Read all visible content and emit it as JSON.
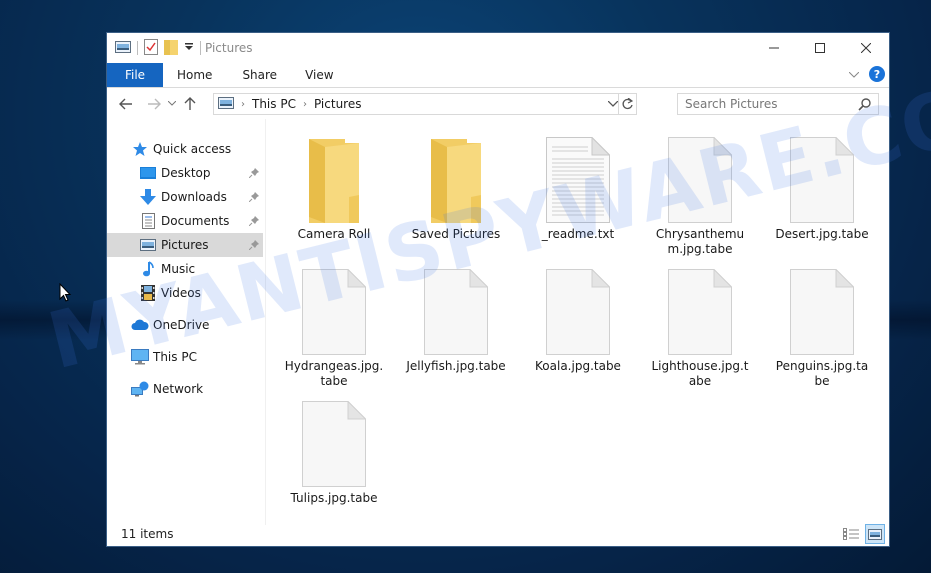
{
  "window": {
    "title": "Pictures",
    "controls": {
      "minimize": "—",
      "maximize": "☐",
      "close": "✕"
    }
  },
  "ribbon": {
    "tabs": [
      {
        "label": "File",
        "active": true
      },
      {
        "label": "Home"
      },
      {
        "label": "Share"
      },
      {
        "label": "View"
      }
    ],
    "help_label": "?"
  },
  "navigation": {
    "breadcrumb": [
      "This PC",
      "Pictures"
    ],
    "search_placeholder": "Search Pictures"
  },
  "sidebar": {
    "items": [
      {
        "label": "Quick access",
        "icon": "star-icon"
      },
      {
        "label": "Desktop",
        "icon": "desktop-icon",
        "pinned": true
      },
      {
        "label": "Downloads",
        "icon": "download-arrow-icon",
        "pinned": true
      },
      {
        "label": "Documents",
        "icon": "document-icon",
        "pinned": true
      },
      {
        "label": "Pictures",
        "icon": "pictures-icon",
        "pinned": true,
        "selected": true
      },
      {
        "label": "Music",
        "icon": "music-note-icon"
      },
      {
        "label": "Videos",
        "icon": "film-icon"
      },
      {
        "label": "OneDrive",
        "icon": "cloud-icon"
      },
      {
        "label": "This PC",
        "icon": "monitor-icon"
      },
      {
        "label": "Network",
        "icon": "network-icon"
      }
    ]
  },
  "files": [
    {
      "name": "Camera Roll",
      "type": "folder"
    },
    {
      "name": "Saved Pictures",
      "type": "folder"
    },
    {
      "name": "_readme.txt",
      "type": "text"
    },
    {
      "name": "Chrysanthemum.jpg.tabe",
      "type": "blank"
    },
    {
      "name": "Desert.jpg.tabe",
      "type": "blank"
    },
    {
      "name": "Hydrangeas.jpg.tabe",
      "type": "blank"
    },
    {
      "name": "Jellyfish.jpg.tabe",
      "type": "blank"
    },
    {
      "name": "Koala.jpg.tabe",
      "type": "blank"
    },
    {
      "name": "Lighthouse.jpg.tabe",
      "type": "blank"
    },
    {
      "name": "Penguins.jpg.tabe",
      "type": "blank"
    },
    {
      "name": "Tulips.jpg.tabe",
      "type": "blank"
    }
  ],
  "status": {
    "item_count": "11 items"
  },
  "watermark": "MYANTISPYWARE.COM",
  "colors": {
    "accent": "#1565c0",
    "selected": "#d9d9d9",
    "folder": "#f5d36e",
    "desktop": "#0a3d6b"
  }
}
